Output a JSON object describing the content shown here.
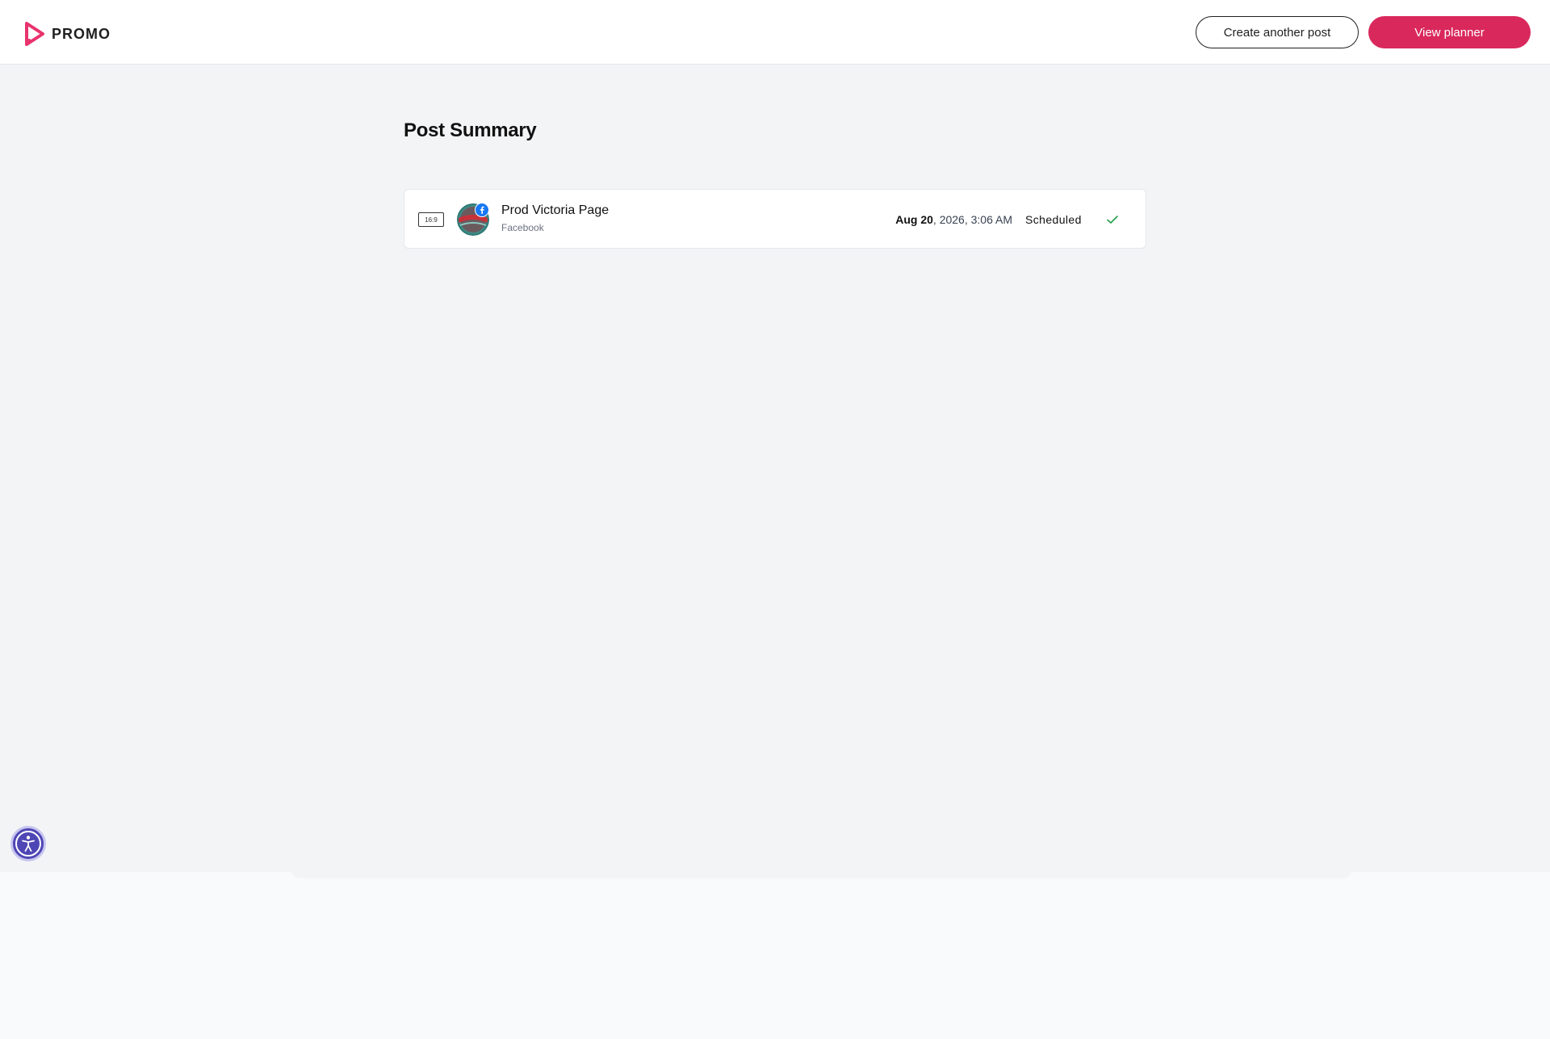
{
  "header": {
    "brand": "PROMO",
    "logo_icon": "promo-play-logo",
    "create_button_label": "Create another post",
    "planner_button_label": "View planner",
    "accent_color": "#d9285c"
  },
  "main": {
    "title": "Post Summary",
    "posts": [
      {
        "aspect_ratio": "16:9",
        "account_name": "Prod Victoria Page",
        "platform": "Facebook",
        "platform_icon": "facebook-icon",
        "date": "Aug 20",
        "date_rest": ", 2026, 3:06 AM",
        "status": "Scheduled",
        "status_icon": "check-icon",
        "status_color": "#22a04b"
      }
    ]
  },
  "accessibility": {
    "icon": "accessibility-icon",
    "color": "#4f46b5"
  }
}
